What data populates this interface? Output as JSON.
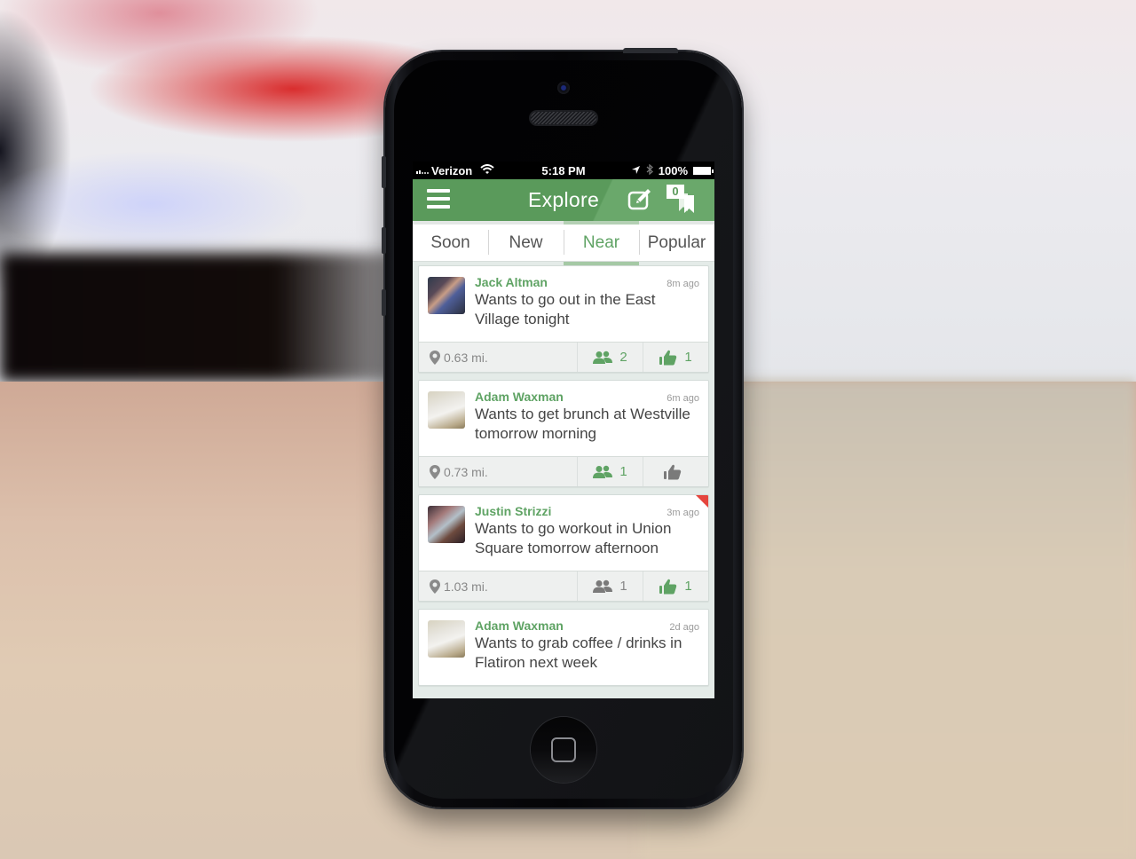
{
  "status_bar": {
    "carrier": "Verizon",
    "time": "5:18 PM",
    "battery": "100%"
  },
  "nav": {
    "title": "Explore",
    "menu_icon": "hamburger-menu-icon",
    "compose_icon": "compose-icon",
    "bookmarks_icon": "bookmarks-icon",
    "bookmarks_badge": "0"
  },
  "tabs": [
    {
      "label": "Soon",
      "active": false
    },
    {
      "label": "New",
      "active": false
    },
    {
      "label": "Near",
      "active": true
    },
    {
      "label": "Popular",
      "active": false
    }
  ],
  "colors": {
    "brand_green": "#5d9e5e",
    "accent_green": "#5fa364",
    "flag_red": "#e5453d"
  },
  "feed": [
    {
      "author": "Jack Altman",
      "ago": "8m ago",
      "message": "Wants to go out in the East Village tonight",
      "distance": "0.63 mi.",
      "people_count": "2",
      "people_active": true,
      "likes_count": "1",
      "likes_active": true,
      "flagged": false
    },
    {
      "author": "Adam Waxman",
      "ago": "6m ago",
      "message": "Wants to get brunch at Westville tomorrow morning",
      "distance": "0.73 mi.",
      "people_count": "1",
      "people_active": true,
      "likes_count": "",
      "likes_active": false,
      "flagged": false
    },
    {
      "author": "Justin Strizzi",
      "ago": "3m ago",
      "message": "Wants to go workout in Union Square tomorrow afternoon",
      "distance": "1.03 mi.",
      "people_count": "1",
      "people_active": false,
      "likes_count": "1",
      "likes_active": true,
      "flagged": true
    },
    {
      "author": "Adam Waxman",
      "ago": "2d ago",
      "message": "Wants to grab coffee / drinks in Flatiron next week"
    }
  ]
}
